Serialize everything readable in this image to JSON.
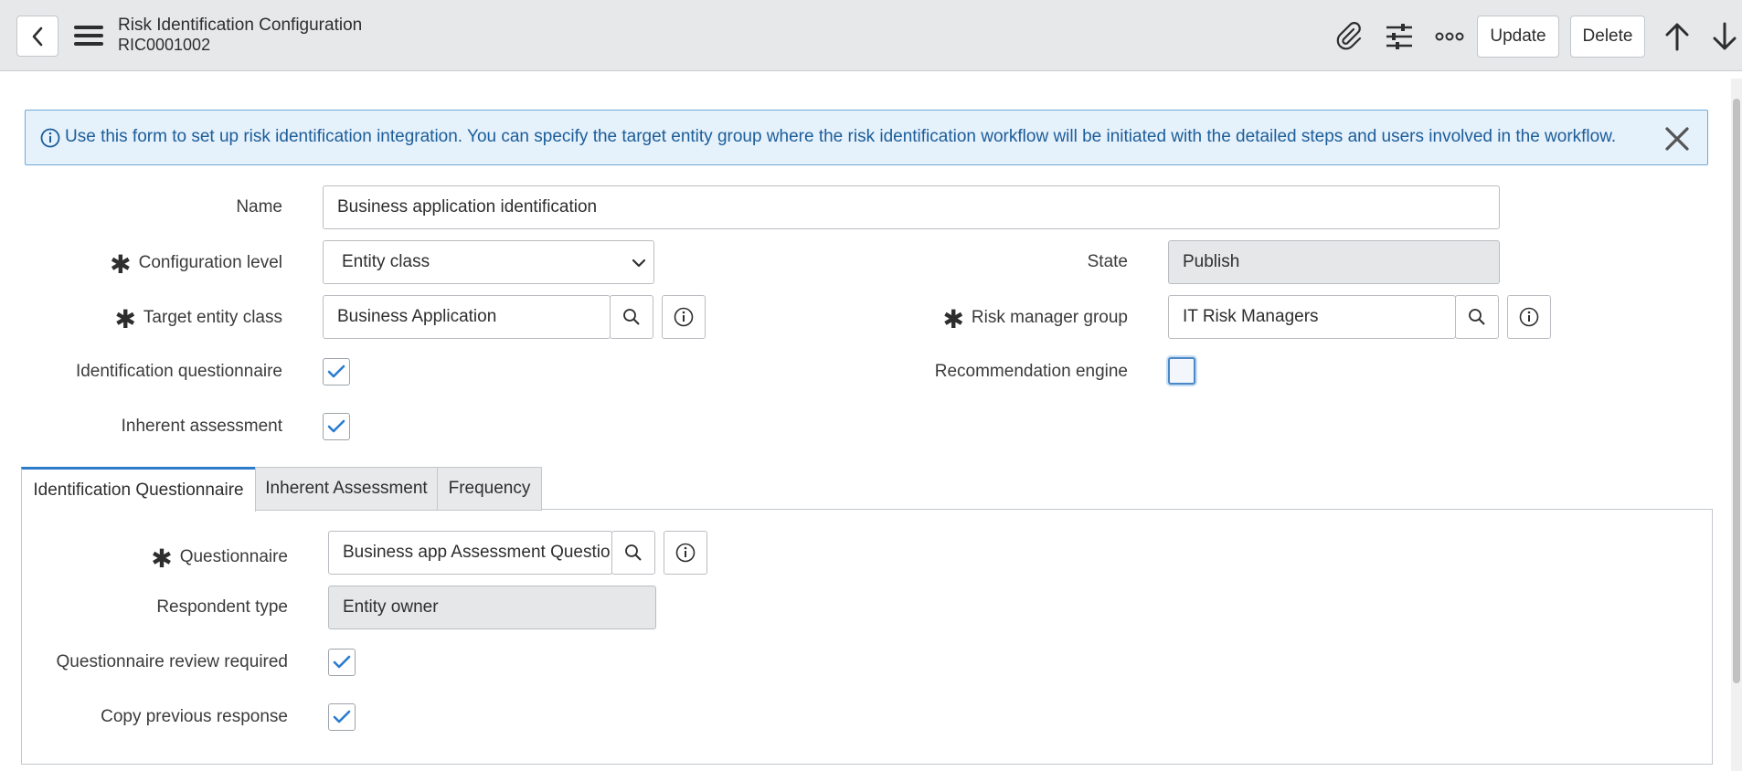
{
  "header": {
    "title": "Risk Identification Configuration",
    "number": "RIC0001002",
    "update_label": "Update",
    "delete_label": "Delete"
  },
  "banner": {
    "text": "Use this form to set up risk identification integration. You can specify the target entity group where the risk identification workflow will be initiated with the detailed steps and users involved in the workflow."
  },
  "form": {
    "name": {
      "label": "Name",
      "value": "Business application identification"
    },
    "configuration_level": {
      "label": "Configuration level",
      "value": "Entity class"
    },
    "state": {
      "label": "State",
      "value": "Publish"
    },
    "target_entity_class": {
      "label": "Target entity class",
      "value": "Business Application"
    },
    "risk_manager_group": {
      "label": "Risk manager group",
      "value": "IT Risk Managers"
    },
    "identification_questionnaire": {
      "label": "Identification questionnaire",
      "checked": true
    },
    "recommendation_engine": {
      "label": "Recommendation engine",
      "checked": false
    },
    "inherent_assessment": {
      "label": "Inherent assessment",
      "checked": true
    }
  },
  "tabs": [
    {
      "label": "Identification Questionnaire",
      "active": true
    },
    {
      "label": "Inherent Assessment",
      "active": false
    },
    {
      "label": "Frequency",
      "active": false
    }
  ],
  "tab_panel": {
    "questionnaire": {
      "label": "Questionnaire",
      "value": "Business app Assessment Questio"
    },
    "respondent_type": {
      "label": "Respondent type",
      "value": "Entity owner"
    },
    "questionnaire_review_required": {
      "label": "Questionnaire review required",
      "checked": true
    },
    "copy_previous_response": {
      "label": "Copy previous response",
      "checked": true
    }
  },
  "colors": {
    "accent": "#2d7cc9",
    "banner_bg": "#e5f1fb",
    "banner_text": "#1c5d99",
    "check": "#2b7bd0"
  }
}
